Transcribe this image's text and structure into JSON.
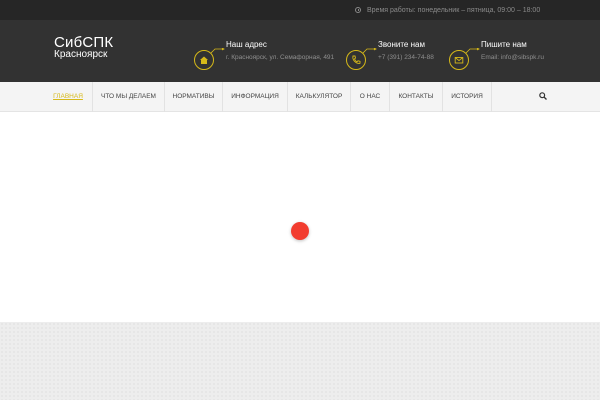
{
  "topbar": {
    "hours_text": "Время работы: понедельник – пятница, 09:00 – 18:00",
    "icon": "clock-icon"
  },
  "header": {
    "logo_line1": "СибСПК",
    "logo_line2": "Красноярск",
    "contacts": [
      {
        "title": "Наш адрес",
        "value": "г. Красноярск, ул. Семафорная, 491",
        "icon": "home-icon"
      },
      {
        "title": "Звоните нам",
        "value": "+7 (391) 234-74-88",
        "icon": "phone-icon"
      },
      {
        "title": "Пишите нам",
        "value": "Email: info@sibspk.ru",
        "icon": "mail-icon"
      }
    ],
    "accent_color": "#d6b919"
  },
  "nav": {
    "items": [
      {
        "label": "ГЛАВНАЯ",
        "active": true
      },
      {
        "label": "ЧТО МЫ ДЕЛАЕМ",
        "active": false
      },
      {
        "label": "НОРМАТИВЫ",
        "active": false
      },
      {
        "label": "ИНФОРМАЦИЯ",
        "active": false
      },
      {
        "label": "КАЛЬКУЛЯТОР",
        "active": false
      },
      {
        "label": "О НАС",
        "active": false
      },
      {
        "label": "КОНТАКТЫ",
        "active": false
      },
      {
        "label": "ИСТОРИЯ",
        "active": false
      }
    ],
    "search_icon": "search-icon"
  },
  "content": {
    "loader_color": "#f23c2f"
  }
}
